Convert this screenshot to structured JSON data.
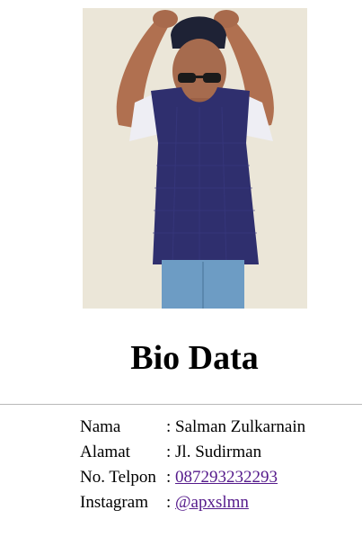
{
  "header": {
    "title": "Bio Data"
  },
  "photo": {
    "alt": "Foto Salman Zulkarnain"
  },
  "bio": {
    "rows": [
      {
        "label": "Nama",
        "separator": ":",
        "value": "Salman Zulkarnain"
      },
      {
        "label": "Alamat",
        "separator": ":",
        "value": "Jl. Sudirman"
      },
      {
        "label": "No. Telpon",
        "separator": ":",
        "value": "087293232293"
      },
      {
        "label": "Instagram",
        "separator": ":",
        "value": "@apxslmn"
      }
    ]
  },
  "colors": {
    "visited_link": "#551a8b",
    "divider": "#b8b8b8",
    "shirt": "#2f2f6e",
    "pants": "#6d9cc4",
    "wall": "#e9e4d6"
  }
}
